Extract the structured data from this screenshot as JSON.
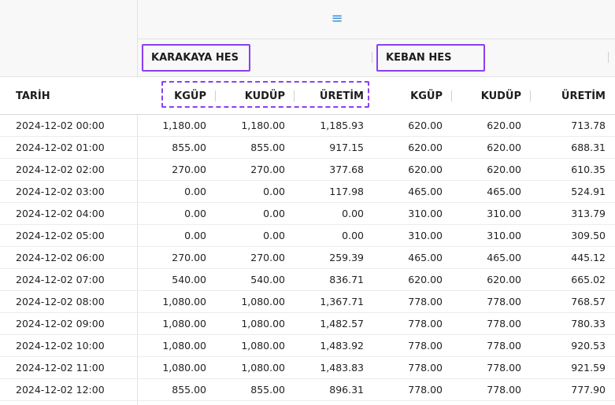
{
  "toolbar": {
    "menu_icon": "menu-icon"
  },
  "groups": [
    {
      "label": "KARAKAYA HES"
    },
    {
      "label": "KEBAN HES"
    }
  ],
  "columns": [
    "TARİH",
    "KGÜP",
    "KUDÜP",
    "ÜRETİM",
    "KGÜP",
    "KUDÜP",
    "ÜRETİM"
  ],
  "rows": [
    [
      "2024-12-02 00:00",
      "1,180.00",
      "1,180.00",
      "1,185.93",
      "620.00",
      "620.00",
      "713.78"
    ],
    [
      "2024-12-02 01:00",
      "855.00",
      "855.00",
      "917.15",
      "620.00",
      "620.00",
      "688.31"
    ],
    [
      "2024-12-02 02:00",
      "270.00",
      "270.00",
      "377.68",
      "620.00",
      "620.00",
      "610.35"
    ],
    [
      "2024-12-02 03:00",
      "0.00",
      "0.00",
      "117.98",
      "465.00",
      "465.00",
      "524.91"
    ],
    [
      "2024-12-02 04:00",
      "0.00",
      "0.00",
      "0.00",
      "310.00",
      "310.00",
      "313.79"
    ],
    [
      "2024-12-02 05:00",
      "0.00",
      "0.00",
      "0.00",
      "310.00",
      "310.00",
      "309.50"
    ],
    [
      "2024-12-02 06:00",
      "270.00",
      "270.00",
      "259.39",
      "465.00",
      "465.00",
      "445.12"
    ],
    [
      "2024-12-02 07:00",
      "540.00",
      "540.00",
      "836.71",
      "620.00",
      "620.00",
      "665.02"
    ],
    [
      "2024-12-02 08:00",
      "1,080.00",
      "1,080.00",
      "1,367.71",
      "778.00",
      "778.00",
      "768.57"
    ],
    [
      "2024-12-02 09:00",
      "1,080.00",
      "1,080.00",
      "1,482.57",
      "778.00",
      "778.00",
      "780.33"
    ],
    [
      "2024-12-02 10:00",
      "1,080.00",
      "1,080.00",
      "1,483.92",
      "778.00",
      "778.00",
      "920.53"
    ],
    [
      "2024-12-02 11:00",
      "1,080.00",
      "1,080.00",
      "1,483.83",
      "778.00",
      "778.00",
      "921.59"
    ],
    [
      "2024-12-02 12:00",
      "855.00",
      "855.00",
      "896.31",
      "778.00",
      "778.00",
      "777.90"
    ]
  ],
  "colors": {
    "highlight": "#8a3ff0",
    "menu_icon": "#3f8fdc",
    "header_bg": "#f8f8f8"
  }
}
